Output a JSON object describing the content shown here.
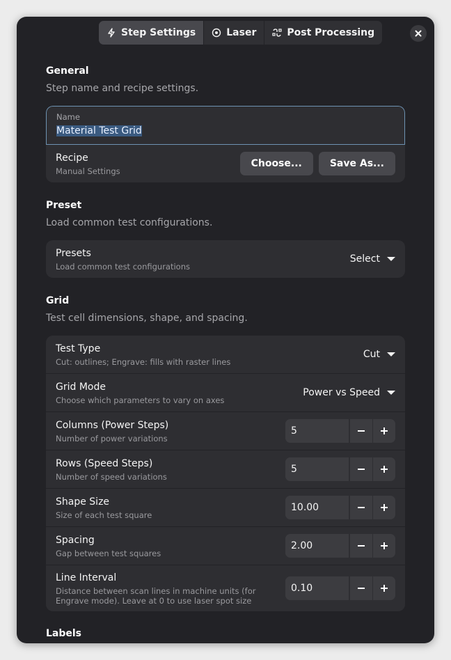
{
  "tabs": [
    {
      "label": "Step Settings",
      "icon": "bolt-icon"
    },
    {
      "label": "Laser",
      "icon": "target-icon"
    },
    {
      "label": "Post Processing",
      "icon": "workflow-icon"
    }
  ],
  "general": {
    "title": "General",
    "desc": "Step name and recipe settings.",
    "name_label": "Name",
    "name_value": "Material Test Grid",
    "recipe_title": "Recipe",
    "recipe_sub": "Manual Settings",
    "choose_label": "Choose...",
    "save_as_label": "Save As..."
  },
  "preset": {
    "title": "Preset",
    "desc": "Load common test configurations.",
    "row_title": "Presets",
    "row_sub": "Load common test configurations",
    "value": "Select"
  },
  "grid": {
    "title": "Grid",
    "desc": "Test cell dimensions, shape, and spacing.",
    "test_type": {
      "title": "Test Type",
      "sub": "Cut: outlines; Engrave: fills with raster lines",
      "value": "Cut"
    },
    "grid_mode": {
      "title": "Grid Mode",
      "sub": "Choose which parameters to vary on axes",
      "value": "Power vs Speed"
    },
    "columns": {
      "title": "Columns (Power Steps)",
      "sub": "Number of power variations",
      "value": "5"
    },
    "rows": {
      "title": "Rows (Speed Steps)",
      "sub": "Number of speed variations",
      "value": "5"
    },
    "shape_size": {
      "title": "Shape Size",
      "sub": "Size of each test square",
      "value": "10.00"
    },
    "spacing": {
      "title": "Spacing",
      "sub": "Gap between test squares",
      "value": "2.00"
    },
    "line_interval": {
      "title": "Line Interval",
      "sub": "Distance between scan lines in machine units (for Engrave mode). Leave at 0 to use laser spot size",
      "value": "0.10"
    }
  },
  "labels": {
    "title": "Labels"
  }
}
